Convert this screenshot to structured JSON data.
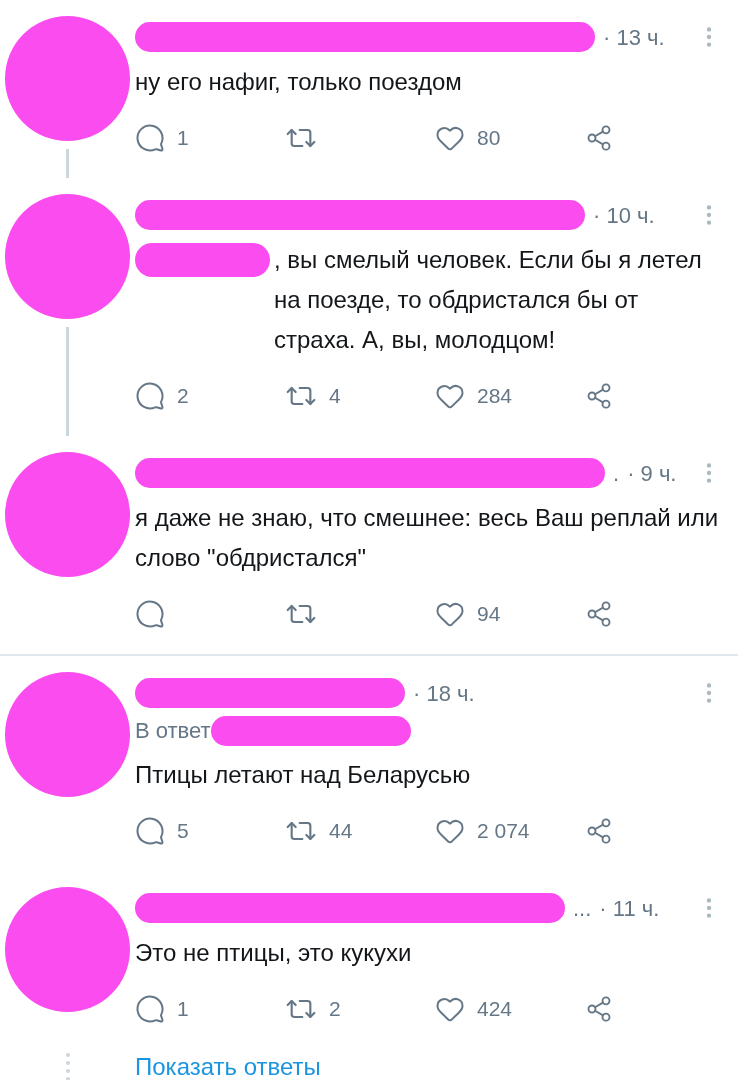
{
  "tweets": [
    {
      "connected": true,
      "time": "· 13 ч.",
      "text": "ну его нафиг, только поездом",
      "text_lead_redacted": false,
      "actions": {
        "replies": "1",
        "likes": "80"
      },
      "divider_after": false
    },
    {
      "connected": true,
      "time": "· 10 ч.",
      "text": ", вы смелый  человек. Если бы я летел на поезде, то обдристался бы от страха. А, вы, молодцом!",
      "text_lead_redacted": true,
      "actions": {
        "replies": "2",
        "retweets": "4",
        "likes": "284"
      },
      "divider_after": false
    },
    {
      "connected": false,
      "name_suffix": ".",
      "time": "· 9 ч.",
      "text": "я даже не знаю, что смешнее: весь Ваш реплай или слово \"обдристался\"",
      "text_lead_redacted": false,
      "actions": {
        "likes": "94"
      },
      "divider_after": true
    },
    {
      "connected": false,
      "time": "· 18 ч.",
      "reply_to": "В ответ",
      "text": "Птицы летают над Беларусью",
      "text_lead_redacted": false,
      "actions": {
        "replies": "5",
        "retweets": "44",
        "likes": "2 074"
      },
      "divider_after": false
    },
    {
      "connected": false,
      "name_suffix": "...",
      "time": "· 11 ч.",
      "text": "Это не птицы, это кукухи",
      "text_lead_redacted": false,
      "actions": {
        "replies": "1",
        "retweets": "2",
        "likes": "424"
      },
      "divider_after": false
    }
  ],
  "show_replies": "Показать ответы"
}
